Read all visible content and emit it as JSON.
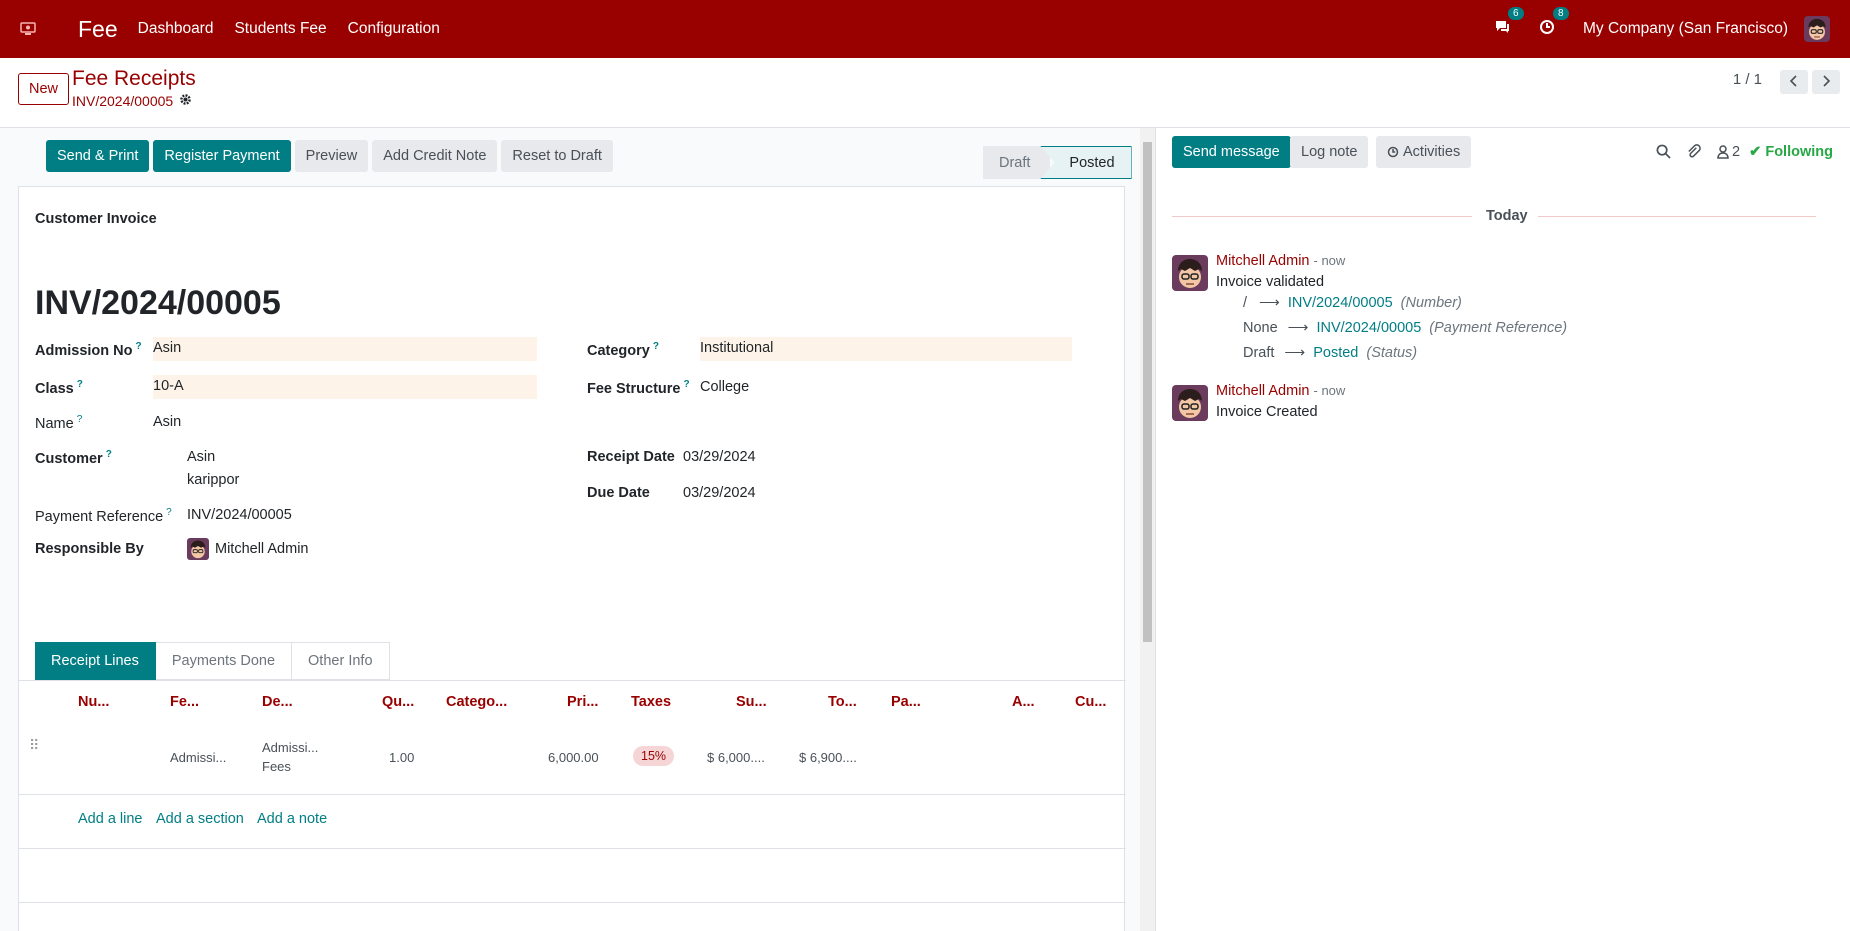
{
  "navbar": {
    "app_name": "Fee",
    "menu": [
      "Dashboard",
      "Students Fee",
      "Configuration"
    ],
    "messages_count": "6",
    "activities_count": "8",
    "company": "My Company (San Francisco)"
  },
  "control": {
    "new_label": "New",
    "title": "Fee Receipts",
    "record": "INV/2024/00005",
    "pager": "1 / 1"
  },
  "actions": {
    "send_print": "Send & Print",
    "register_payment": "Register Payment",
    "preview": "Preview",
    "add_credit_note": "Add Credit Note",
    "reset_to_draft": "Reset to Draft"
  },
  "stages": {
    "draft": "Draft",
    "posted": "Posted"
  },
  "form": {
    "doc_type": "Customer Invoice",
    "number": "INV/2024/00005",
    "admission_no_label": "Admission No",
    "admission_no": "Asin",
    "class_label": "Class",
    "class": "10-A",
    "name_label": "Name",
    "name": "Asin",
    "customer_label": "Customer",
    "customer_name": "Asin",
    "customer_addr": "karippor",
    "payment_ref_label": "Payment Reference",
    "payment_ref": "INV/2024/00005",
    "responsible_label": "Responsible By",
    "responsible": "Mitchell Admin",
    "category_label": "Category",
    "category": "Institutional",
    "fee_structure_label": "Fee Structure",
    "fee_structure": "College",
    "receipt_date_label": "Receipt Date",
    "receipt_date": "03/29/2024",
    "due_date_label": "Due Date",
    "due_date": "03/29/2024",
    "help_mark": "?"
  },
  "tabs": [
    "Receipt Lines",
    "Payments Done",
    "Other Info"
  ],
  "table": {
    "headers": [
      "Nu...",
      "Fe...",
      "De...",
      "Qu...",
      "Catego...",
      "Pri...",
      "Taxes",
      "Su...",
      "To...",
      "Pa...",
      "A...",
      "Cu..."
    ],
    "row": {
      "fee": "Admissi...",
      "desc1": "Admissi...",
      "desc2": "Fees",
      "qty": "1.00",
      "price": "6,000.00",
      "tax": "15%",
      "subtotal": "$ 6,000....",
      "total": "$ 6,900...."
    },
    "add_line": "Add a line",
    "add_section": "Add a section",
    "add_note": "Add a note"
  },
  "chatter": {
    "send_message": "Send message",
    "log_note": "Log note",
    "activities": "Activities",
    "followers_count": "2",
    "following": "Following",
    "today": "Today",
    "messages": [
      {
        "author": "Mitchell Admin",
        "time": "- now",
        "body": "Invoice validated",
        "tracking": [
          {
            "old": "/",
            "new": "INV/2024/00005",
            "field": "(Number)"
          },
          {
            "old": "None",
            "new": "INV/2024/00005",
            "field": "(Payment Reference)"
          },
          {
            "old": "Draft",
            "new": "Posted",
            "field": "(Status)"
          }
        ]
      },
      {
        "author": "Mitchell Admin",
        "time": "- now",
        "body": "Invoice Created"
      }
    ]
  },
  "colors": {
    "brand": "#990000",
    "primary": "#017e84",
    "following": "#28a745"
  }
}
